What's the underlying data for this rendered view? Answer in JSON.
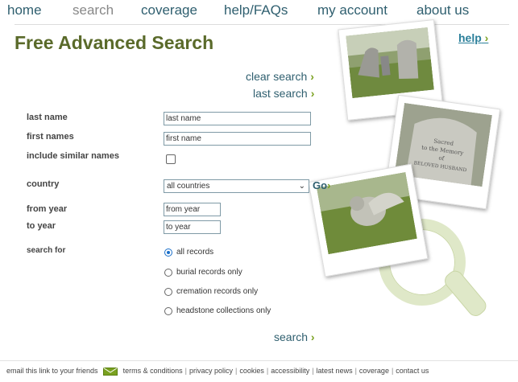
{
  "nav": {
    "home": "home",
    "search": "search",
    "coverage": "coverage",
    "help": "help/FAQs",
    "account": "my account",
    "about": "about us"
  },
  "title": "Free Advanced Search",
  "help_link": "help",
  "links": {
    "clear": "clear search",
    "last": "last search"
  },
  "form": {
    "last_name_label": "last name",
    "last_name_value": "last name",
    "first_names_label": "first names",
    "first_names_value": "first name",
    "similar_label": "include similar names",
    "similar_checked": false,
    "country_label": "country",
    "country_value": "all countries",
    "go": "Go",
    "from_year_label": "from year",
    "from_year_value": "from year",
    "to_year_label": "to year",
    "to_year_value": "to year",
    "search_for_label": "search for",
    "options": [
      {
        "label": "all records",
        "checked": true
      },
      {
        "label": "burial records only",
        "checked": false
      },
      {
        "label": "cremation records only",
        "checked": false
      },
      {
        "label": "headstone collections only",
        "checked": false
      }
    ],
    "submit": "search"
  },
  "footer": {
    "email": "email this link to your friends",
    "links": [
      "terms & conditions",
      "privacy policy",
      "cookies",
      "accessibility",
      "latest news",
      "coverage",
      "contact us"
    ]
  },
  "colors": {
    "accent_green": "#7aa120",
    "title_olive": "#5a6a2a",
    "link_teal": "#2f5f6f"
  }
}
